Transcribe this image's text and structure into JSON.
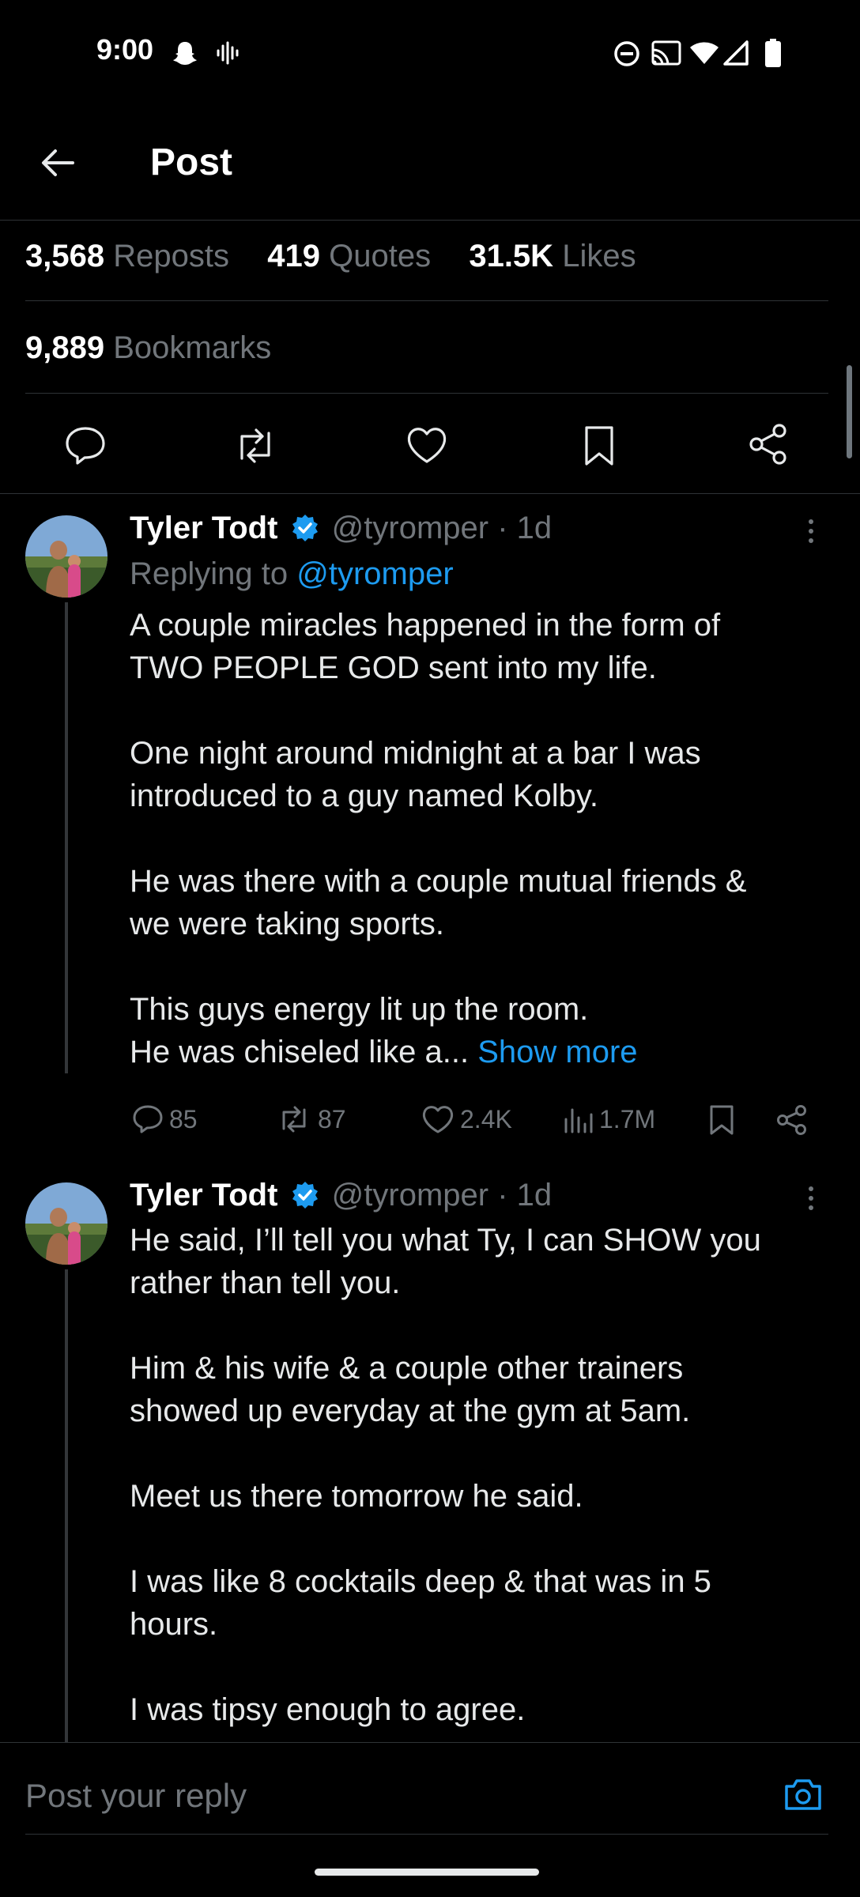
{
  "status_bar": {
    "time": "9:00"
  },
  "header": {
    "title": "Post"
  },
  "stats": {
    "reposts_count": "3,568",
    "reposts_label": "Reposts",
    "quotes_count": "419",
    "quotes_label": "Quotes",
    "likes_count": "31.5K",
    "likes_label": "Likes",
    "bookmarks_count": "9,889",
    "bookmarks_label": "Bookmarks"
  },
  "replies": [
    {
      "name": "Tyler Todt",
      "handle": "@tyromper",
      "time": "· 1d",
      "replying_to_prefix": "Replying to",
      "replying_to_handle": "@tyromper",
      "text": "A couple miracles happened in the form of\nTWO PEOPLE GOD sent into my life.\n\nOne night around midnight at a bar I was\nintroduced to a guy named Kolby.\n\nHe was there with a couple mutual friends &\nwe were taking sports.\n\nThis guys energy lit up the room.\nHe was chiseled like a...",
      "show_more": "Show more",
      "replies_count": "85",
      "reposts_count": "87",
      "likes_count": "2.4K",
      "views_count": "1.7M"
    },
    {
      "name": "Tyler Todt",
      "handle": "@tyromper",
      "time": "· 1d",
      "text": "He said, I’ll tell you what Ty, I can SHOW you\nrather than tell you.\n\nHim & his wife & a couple other trainers\nshowed up everyday at the gym at 5am.\n\nMeet us there tomorrow he said.\n\nI was like 8 cocktails deep & that was in 5\nhours.\n\nI was tipsy enough to agree."
    }
  ],
  "reply_bar": {
    "placeholder": "Post your reply"
  },
  "colors": {
    "background": "#000000",
    "text": "#e7e9ea",
    "secondary": "#71767b",
    "accent": "#1d9bf0",
    "divider": "#2f3336"
  }
}
